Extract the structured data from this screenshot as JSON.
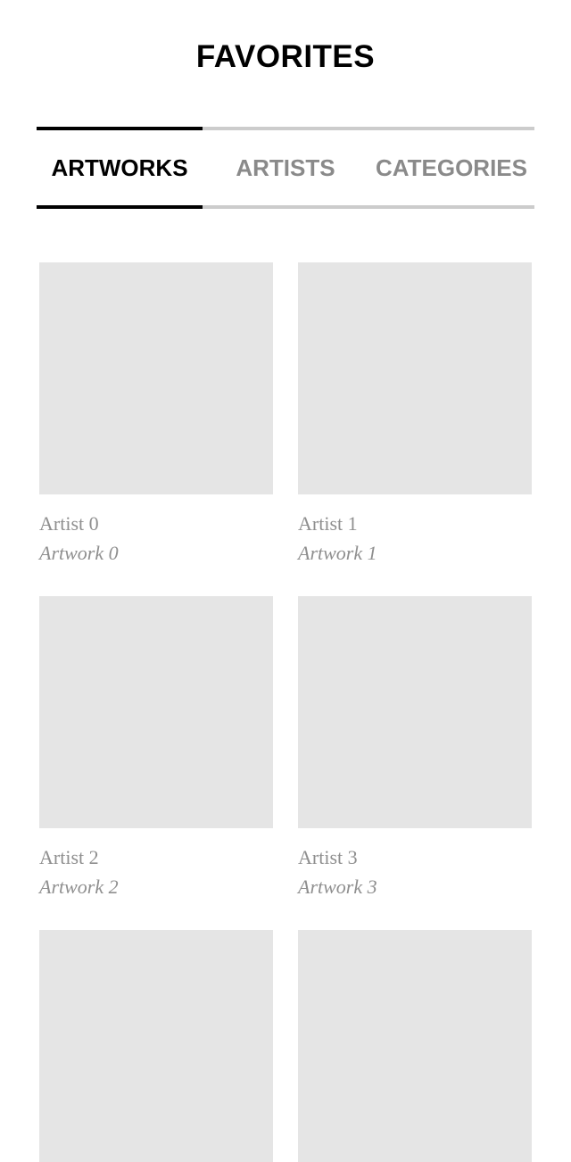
{
  "header": {
    "title": "FAVORITES"
  },
  "tabs": [
    {
      "label": "ARTWORKS",
      "active": true
    },
    {
      "label": "ARTISTS",
      "active": false
    },
    {
      "label": "CATEGORIES",
      "active": false
    }
  ],
  "artworks": [
    {
      "artist": "Artist 0",
      "title": "Artwork 0"
    },
    {
      "artist": "Artist 1",
      "title": "Artwork 1"
    },
    {
      "artist": "Artist 2",
      "title": "Artwork 2"
    },
    {
      "artist": "Artist 3",
      "title": "Artwork 3"
    },
    {
      "artist": "",
      "title": ""
    },
    {
      "artist": "",
      "title": ""
    }
  ],
  "colors": {
    "placeholder": "#e5e5e5",
    "tab_active": "#000000",
    "tab_inactive": "#8a8a8a",
    "tab_border_inactive": "#cccccc",
    "caption": "#8f8f8f"
  }
}
